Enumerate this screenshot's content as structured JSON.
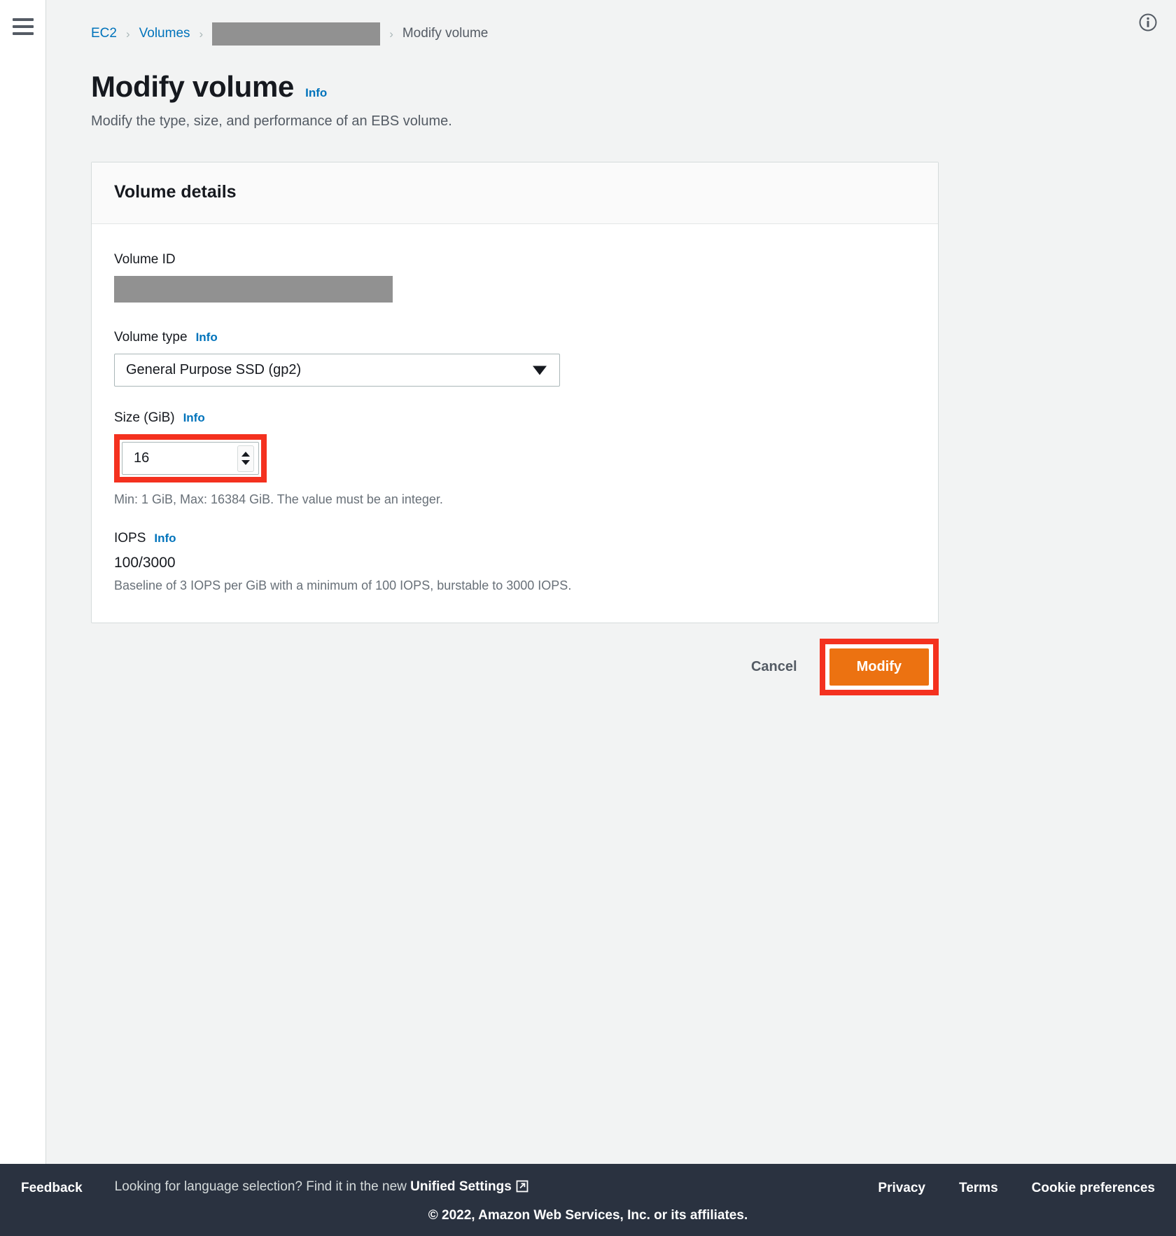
{
  "nav": {
    "menu_icon": "hamburger-menu-icon",
    "info_icon": "info-circle-icon"
  },
  "breadcrumb": {
    "items": [
      {
        "label": "EC2",
        "type": "link"
      },
      {
        "label": "Volumes",
        "type": "link"
      },
      {
        "label": "",
        "type": "redacted"
      },
      {
        "label": "Modify volume",
        "type": "current"
      }
    ],
    "separator": "›"
  },
  "page": {
    "title": "Modify volume",
    "info_label": "Info",
    "description": "Modify the type, size, and performance of an EBS volume."
  },
  "card": {
    "header_title": "Volume details",
    "volume_id": {
      "label": "Volume ID",
      "value": "",
      "redacted": true
    },
    "volume_type": {
      "label": "Volume type",
      "info_label": "Info",
      "selected": "General Purpose SSD (gp2)",
      "caret_icon": "chevron-down-icon"
    },
    "size": {
      "label": "Size (GiB)",
      "info_label": "Info",
      "value": "16",
      "help_text": "Min: 1 GiB, Max: 16384 GiB. The value must be an integer.",
      "stepper_up_icon": "chevron-up-icon",
      "stepper_down_icon": "chevron-down-icon",
      "highlighted": true
    },
    "iops": {
      "label": "IOPS",
      "info_label": "Info",
      "value": "100/3000",
      "help_text": "Baseline of 3 IOPS per GiB with a minimum of 100 IOPS, burstable to 3000 IOPS."
    }
  },
  "actions": {
    "cancel_label": "Cancel",
    "modify_label": "Modify",
    "modify_highlighted": true
  },
  "footer": {
    "feedback_label": "Feedback",
    "language_note_prefix": "Looking for language selection? Find it in the new ",
    "language_note_link": "Unified Settings",
    "external_icon": "external-link-icon",
    "privacy_label": "Privacy",
    "terms_label": "Terms",
    "cookie_label": "Cookie preferences",
    "copyright": "© 2022, Amazon Web Services, Inc. or its affiliates."
  },
  "colors": {
    "accent_link": "#0073bb",
    "brand_orange": "#ec7211",
    "annotation_red": "#f4311f",
    "footer_bg": "#2a3240",
    "page_bg": "#f2f3f3",
    "redaction_gray": "#919191"
  }
}
